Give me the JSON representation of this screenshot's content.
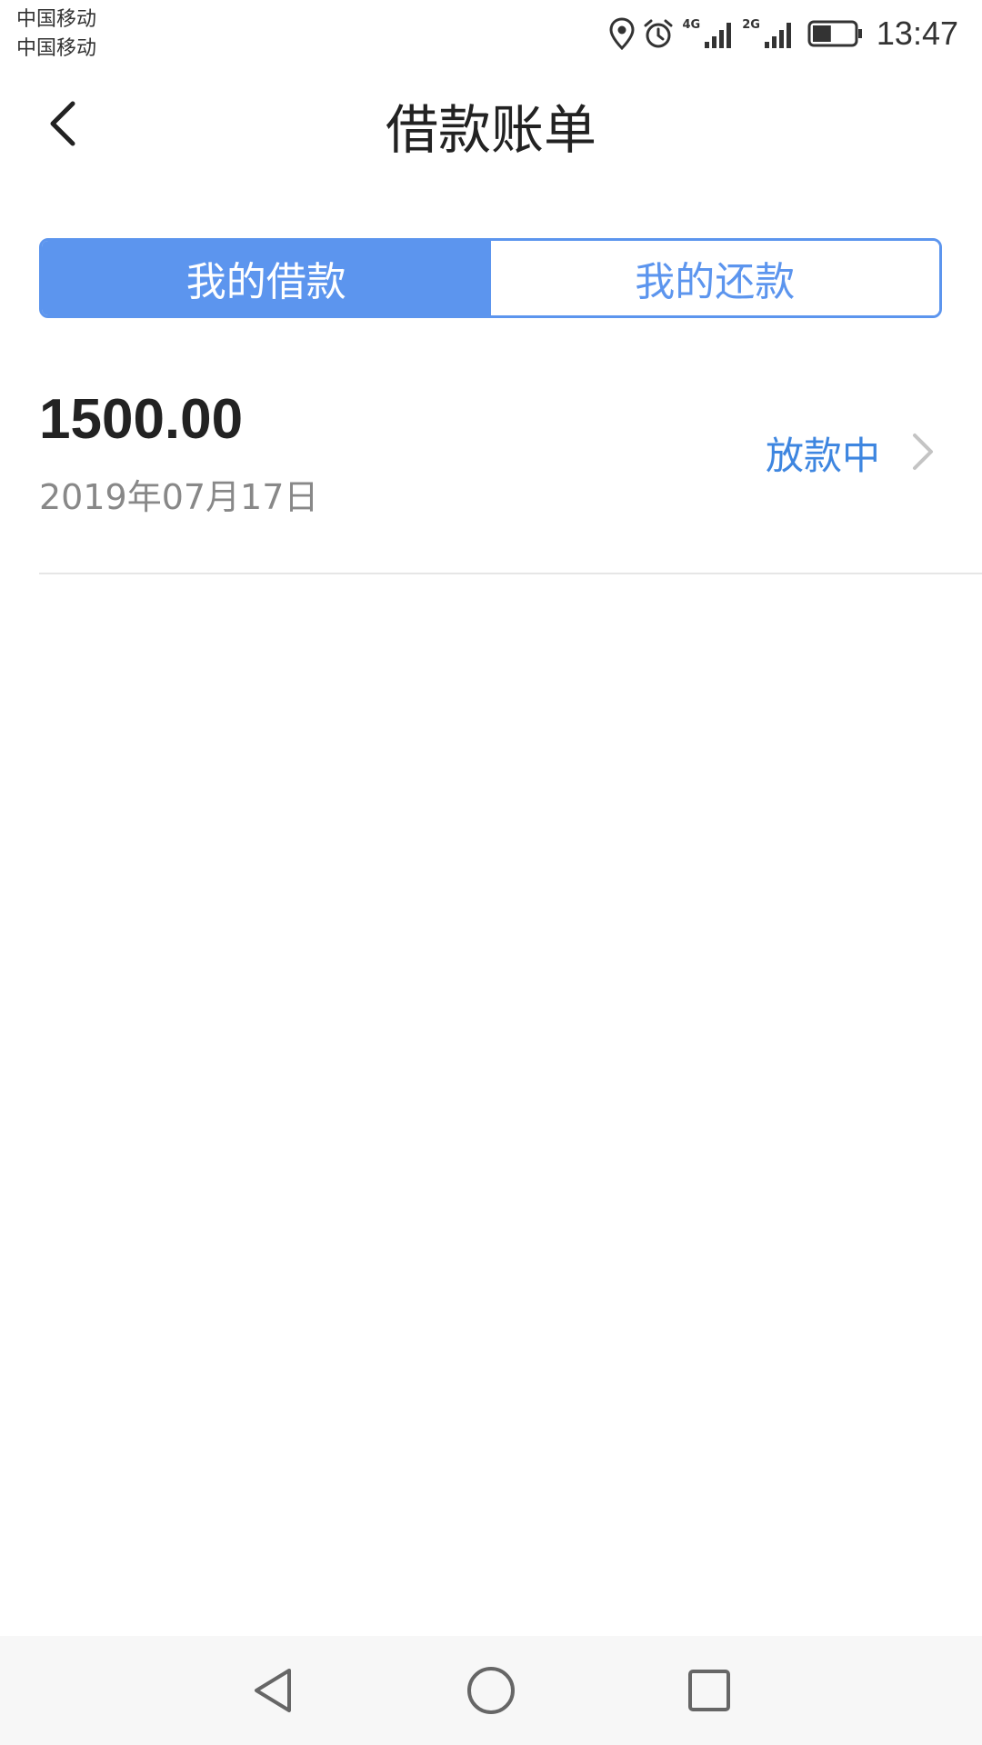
{
  "status_bar": {
    "carrier_1": "中国移动",
    "carrier_2": "中国移动",
    "network_1": "4G",
    "network_2": "2G",
    "time": "13:47",
    "battery_level": 0.45
  },
  "header": {
    "title": "借款账单"
  },
  "tabs": [
    {
      "label": "我的借款",
      "active": true
    },
    {
      "label": "我的还款",
      "active": false
    }
  ],
  "bills": [
    {
      "amount": "1500.00",
      "date": "2019年07月17日",
      "status": "放款中"
    }
  ],
  "colors": {
    "accent": "#5c95ee",
    "status_text": "#3e86e0",
    "divider": "#e6e6e6",
    "nav_bar_bg": "#f7f7f7"
  },
  "icons": {
    "back": "chevron-left-icon",
    "row_arrow": "chevron-right-icon",
    "nav_back": "triangle-back-icon",
    "nav_home": "circle-home-icon",
    "nav_recent": "square-recent-icon"
  }
}
